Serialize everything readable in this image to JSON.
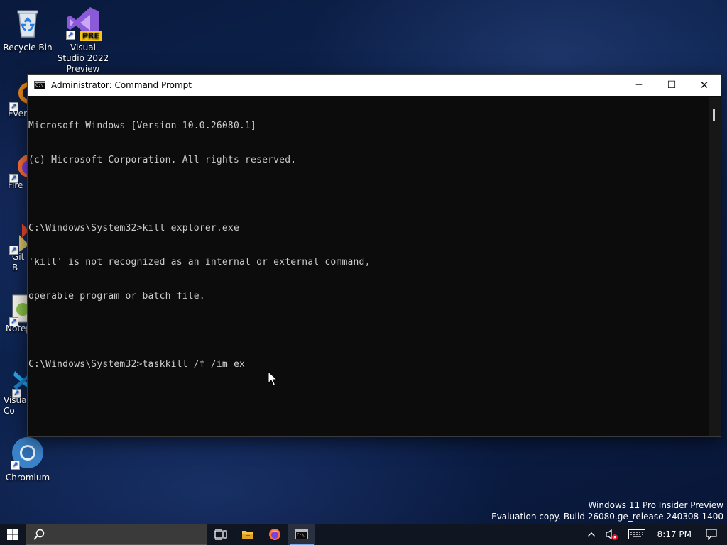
{
  "desktop": {
    "icons": [
      {
        "label": "Recycle Bin"
      },
      {
        "label": "Visual Studio 2022 Preview",
        "badge": "PRE"
      },
      {
        "label": "Every"
      },
      {
        "label": "Fire"
      },
      {
        "label": "Git B"
      },
      {
        "label": "Notep"
      },
      {
        "label": "Visual Co"
      },
      {
        "label": "Chromium"
      }
    ]
  },
  "window": {
    "title": "Administrator: Command Prompt",
    "icon_text": "C:\\",
    "minimize": "─",
    "maximize": "☐",
    "close": "✕"
  },
  "console": {
    "lines": [
      "Microsoft Windows [Version 10.0.26080.1]",
      "(c) Microsoft Corporation. All rights reserved.",
      "",
      "C:\\Windows\\System32>kill explorer.exe",
      "'kill' is not recognized as an internal or external command,",
      "operable program or batch file.",
      "",
      "C:\\Windows\\System32>taskkill /f /im ex"
    ]
  },
  "watermark": {
    "line1": "Windows 11 Pro Insider Preview",
    "line2": "Evaluation copy. Build 26080.ge_release.240308-1400"
  },
  "taskbar": {
    "clock": "8:17 PM",
    "colors": {
      "background": "#101522",
      "active_indicator": "#7aa7e6"
    }
  }
}
